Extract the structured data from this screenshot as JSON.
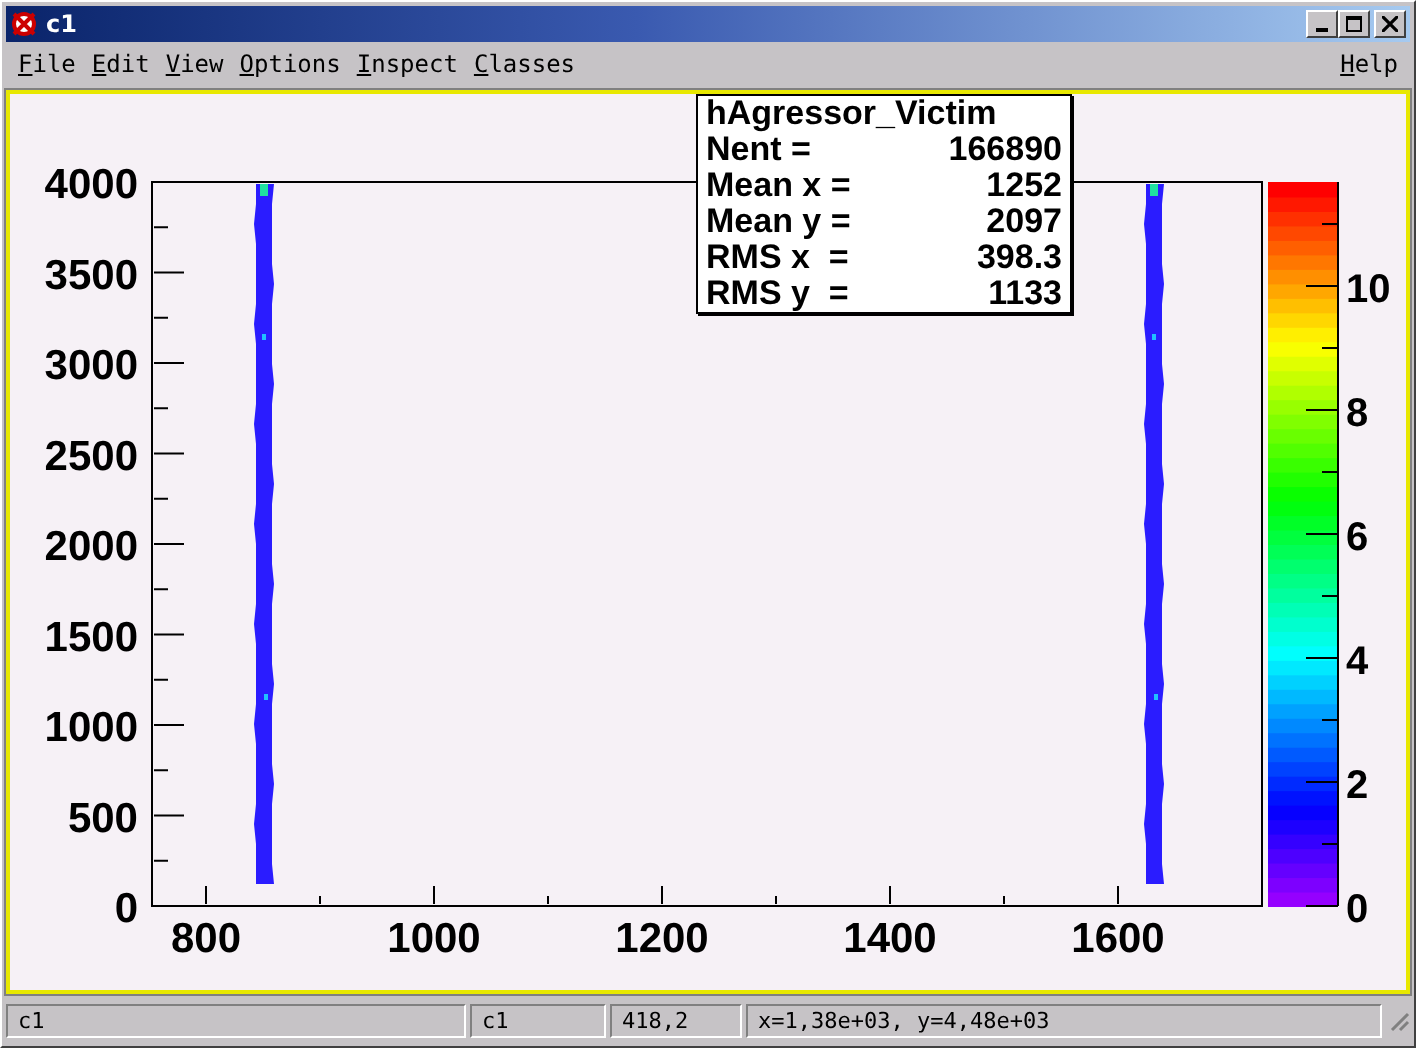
{
  "window": {
    "title": "c1"
  },
  "menu": [
    {
      "label": "File"
    },
    {
      "label": "Edit"
    },
    {
      "label": "View"
    },
    {
      "label": "Options"
    },
    {
      "label": "Inspect"
    },
    {
      "label": "Classes"
    }
  ],
  "help_menu": {
    "label": "Help"
  },
  "canvas": {
    "stats": {
      "title": "hAgressor_Victim",
      "lines": [
        {
          "label": "Nent =",
          "value": "166890"
        },
        {
          "label": "Mean x =",
          "value": "1252"
        },
        {
          "label": "Mean y =",
          "value": "2097"
        },
        {
          "label": "RMS x  =",
          "value": "398.3"
        },
        {
          "label": "RMS y  =",
          "value": "1133"
        }
      ]
    },
    "x_ticks": [
      "800",
      "1000",
      "1200",
      "1400",
      "1600"
    ],
    "y_ticks": [
      "4000",
      "3500",
      "3000",
      "2500",
      "2000",
      "1500",
      "1000",
      "500",
      "0"
    ],
    "z_ticks": [
      "10",
      "8",
      "6",
      "4",
      "2",
      "0"
    ]
  },
  "status_bar": [
    "c1",
    "c1",
    "418,2",
    "x=1,38e+03, y=4,48e+03"
  ]
}
